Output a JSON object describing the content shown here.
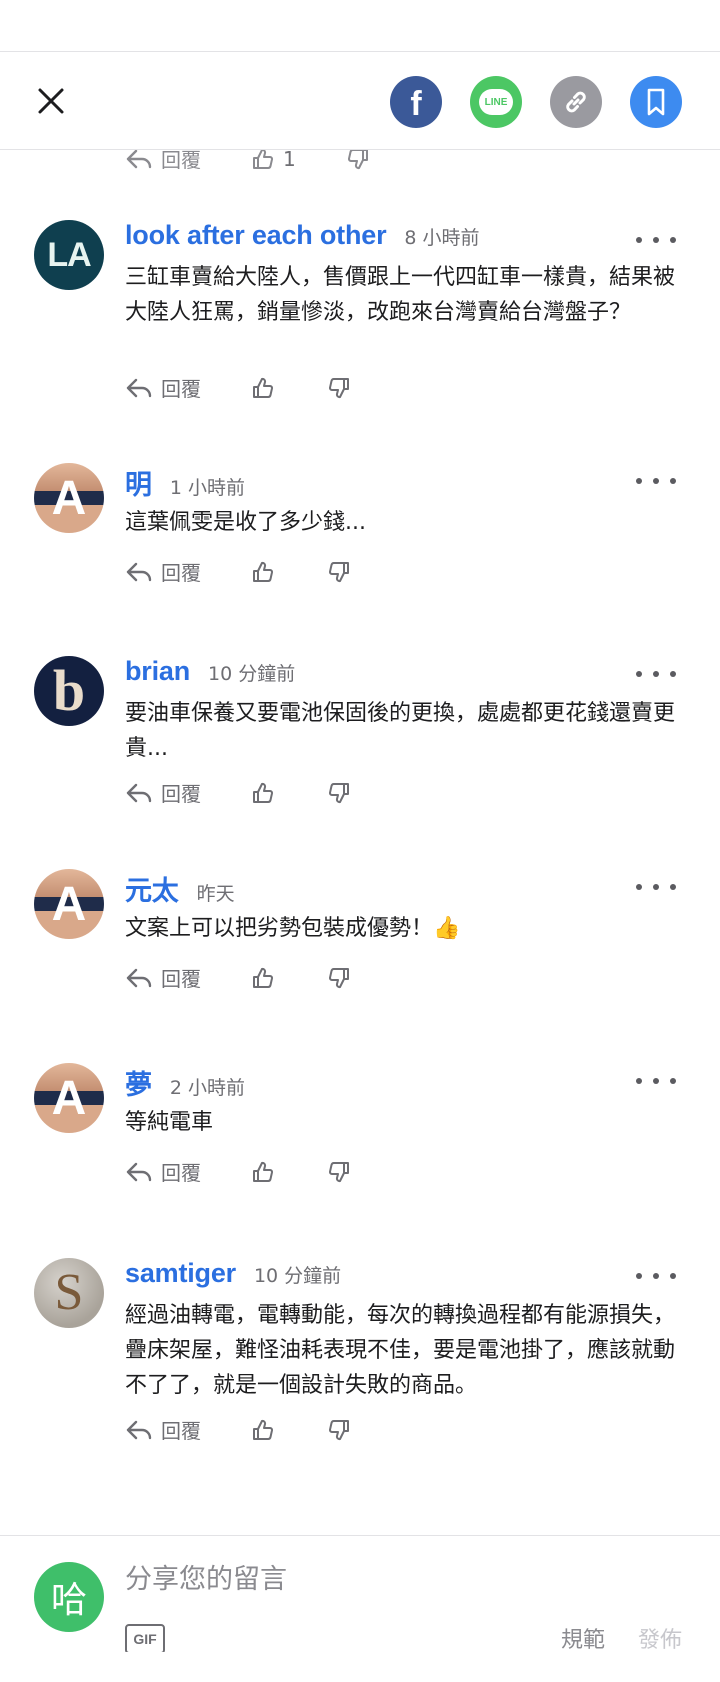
{
  "header": {
    "share_buttons": [
      {
        "icon": "facebook-icon",
        "label": "f",
        "color": "#3b5998"
      },
      {
        "icon": "line-icon",
        "label": "LINE",
        "color": "#4cc764"
      },
      {
        "icon": "link-icon",
        "color": "#9a9aa0"
      },
      {
        "icon": "bookmark-icon",
        "color": "#3d8bf0"
      }
    ]
  },
  "previous_comment_actions": {
    "reply_label": "回覆",
    "like_count": "1"
  },
  "comments": [
    {
      "author": "look after each other",
      "time": "8 小時前",
      "text": "三缸車賣給大陸人，售價跟上一代四缸車一樣貴，結果被大陸人狂罵，銷量慘淡，改跑來台灣賣給台灣盤子？",
      "avatar": {
        "letter": "LA",
        "icon": "avatar-la-icon"
      },
      "reply_label": "回覆"
    },
    {
      "author": "明",
      "time": "1 小時前",
      "text": "這葉佩雯是收了多少錢...",
      "avatar": {
        "letter": "A",
        "icon": "avatar-a-icon"
      },
      "reply_label": "回覆"
    },
    {
      "author": "brian",
      "time": "10 分鐘前",
      "text": "要油車保養又要電池保固後的更換，處處都更花錢還賣更貴...",
      "avatar": {
        "letter": "b",
        "icon": "avatar-b-icon"
      },
      "reply_label": "回覆"
    },
    {
      "author": "元太",
      "time": "昨天",
      "text": "文案上可以把劣勢包裝成優勢！👍",
      "avatar": {
        "letter": "A",
        "icon": "avatar-a-icon"
      },
      "reply_label": "回覆"
    },
    {
      "author": "夢",
      "time": "2 小時前",
      "text": "等純電車",
      "avatar": {
        "letter": "A",
        "icon": "avatar-a-icon"
      },
      "reply_label": "回覆"
    },
    {
      "author": "samtiger",
      "time": "10 分鐘前",
      "text": "經過油轉電，電轉動能，每次的轉換過程都有能源損失，疊床架屋，難怪油耗表現不佳，要是電池掛了，應該就動不了了，就是一個設計失敗的商品。",
      "avatar": {
        "letter": "S",
        "icon": "avatar-s-icon"
      },
      "reply_label": "回覆"
    }
  ],
  "composer": {
    "avatar_letter": "哈",
    "placeholder": "分享您的留言",
    "gif_label": "GIF",
    "guidelines_label": "規範",
    "post_label": "發佈"
  },
  "colors": {
    "author": "#2b6fe0",
    "muted": "#6e6e73",
    "composer_avatar": "#3fbf6a"
  }
}
